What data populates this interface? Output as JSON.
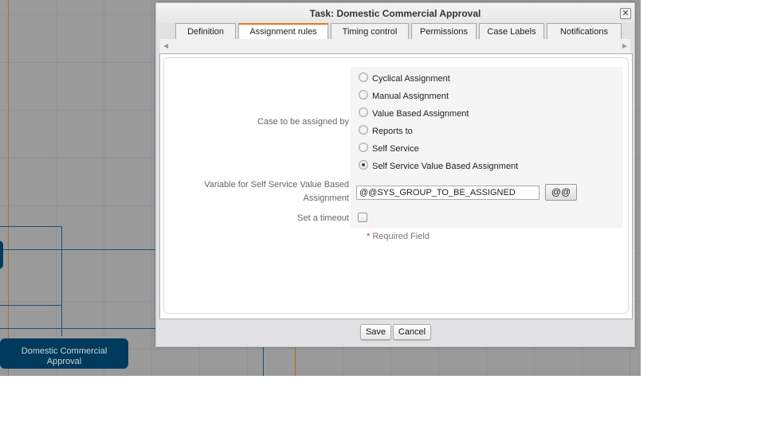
{
  "canvas": {
    "node_label": "Domestic Commercial Approval",
    "node_color": "#003a5c"
  },
  "dialog": {
    "title": "Task: Domestic Commercial Approval",
    "close_icon": "close-icon",
    "tabs": [
      {
        "label": "Definition"
      },
      {
        "label": "Assignment rules",
        "active": true
      },
      {
        "label": "Timing control"
      },
      {
        "label": "Permissions"
      },
      {
        "label": "Case Labels"
      },
      {
        "label": "Notifications"
      }
    ],
    "form": {
      "case_assigned_label": "Case to be assigned by",
      "options": [
        {
          "label": "Cyclical Assignment",
          "checked": false
        },
        {
          "label": "Manual Assignment",
          "checked": false
        },
        {
          "label": "Value Based Assignment",
          "checked": false
        },
        {
          "label": "Reports to",
          "checked": false
        },
        {
          "label": "Self Service",
          "checked": false
        },
        {
          "label": "Self Service Value Based Assignment",
          "checked": true
        }
      ],
      "variable_label": "Variable for Self Service Value Based Assignment",
      "variable_value": "@@SYS_GROUP_TO_BE_ASSIGNED",
      "variable_button": "@@",
      "timeout_label": "Set a timeout",
      "timeout_checked": false,
      "required_star": "*",
      "required_text": "Required Field"
    },
    "save_label": "Save",
    "cancel_label": "Cancel",
    "accent_color": "#e07b1a"
  }
}
